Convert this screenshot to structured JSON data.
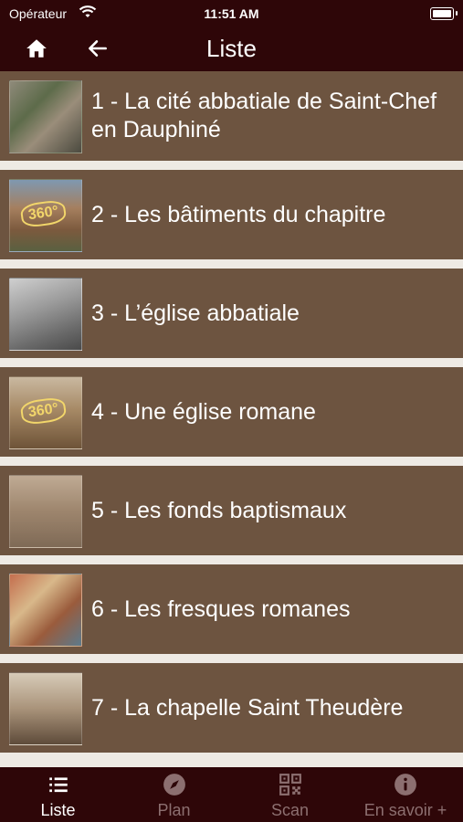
{
  "status_bar": {
    "carrier": "Opérateur",
    "time": "11:51 AM"
  },
  "nav": {
    "title": "Liste",
    "home_icon": "home-icon",
    "back_icon": "arrow-left-icon"
  },
  "colors": {
    "dark": "#2e0608",
    "item_bg": "#6d5440",
    "inactive_tab": "#8c6f70"
  },
  "items": [
    {
      "label": "1 - La cité abbatiale de Saint-Chef en Dauphiné",
      "thumb": "village-photo",
      "has_360": false
    },
    {
      "label": "2 - Les bâtiments du chapitre",
      "thumb": "buildings-photo",
      "has_360": true
    },
    {
      "label": "3 - L’église abbatiale",
      "thumb": "church-photo",
      "has_360": false
    },
    {
      "label": "4 - Une église romane",
      "thumb": "nave-photo",
      "has_360": true
    },
    {
      "label": "5 - Les fonds baptismaux",
      "thumb": "font-photo",
      "has_360": false
    },
    {
      "label": "6 - Les fresques romanes",
      "thumb": "fresco-photo",
      "has_360": false
    },
    {
      "label": "7 - La chapelle Saint Theudère",
      "thumb": "chapel-photo",
      "has_360": false
    }
  ],
  "badge_360": "360°",
  "tabs": [
    {
      "label": "Liste",
      "icon": "list-icon",
      "active": true
    },
    {
      "label": "Plan",
      "icon": "compass-icon",
      "active": false
    },
    {
      "label": "Scan",
      "icon": "qr-code-icon",
      "active": false
    },
    {
      "label": "En savoir +",
      "icon": "info-icon",
      "active": false
    }
  ]
}
